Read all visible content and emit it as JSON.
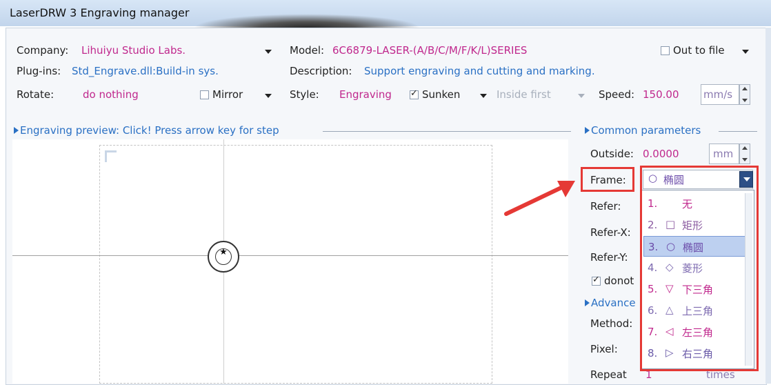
{
  "window": {
    "title": "LaserDRW 3 Engraving manager"
  },
  "company": {
    "label": "Company:",
    "value": "Lihuiyu Studio Labs."
  },
  "model": {
    "label": "Model:",
    "value": "6C6879-LASER-(A/B/C/M/F/K/L)SERIES"
  },
  "out_to_file": {
    "label": "Out to file",
    "checked": false
  },
  "plugins": {
    "label": "Plug-ins:",
    "value": "Std_Engrave.dll:Build-in sys."
  },
  "description": {
    "label": "Description:",
    "value": "Support engraving and cutting and marking."
  },
  "rotate": {
    "label": "Rotate:",
    "value": "do nothing"
  },
  "mirror": {
    "label": "Mirror",
    "checked": false
  },
  "style": {
    "label": "Style:",
    "value": "Engraving"
  },
  "sunken": {
    "label": "Sunken",
    "checked": true
  },
  "inside_first": {
    "value": "Inside first"
  },
  "speed": {
    "label": "Speed:",
    "value": "150.00",
    "unit": "mm/s"
  },
  "preview": {
    "header": "Engraving preview: Click! Press arrow key for step"
  },
  "common": {
    "header": "Common parameters",
    "outside_label": "Outside:",
    "outside_value": "0.0000",
    "outside_unit": "mm",
    "frame_label": "Frame:",
    "frame_value": "椭圆",
    "refer_label": "Refer:",
    "refer_x_label": "Refer-X:",
    "refer_y_label": "Refer-Y:",
    "donot_label": "donot",
    "donot_checked": true
  },
  "advanced": {
    "header": "Advance",
    "method_label": "Method:",
    "pixel_label": "Pixel:",
    "repeat_label": "Repeat",
    "repeat_value": "1",
    "repeat_unit": "times"
  },
  "frame_options": [
    {
      "num": "1.",
      "symbol": "",
      "text": "无",
      "color": "#c0288d"
    },
    {
      "num": "2.",
      "symbol": "□",
      "text": "矩形",
      "color": "#8a5aa0"
    },
    {
      "num": "3.",
      "symbol": "○",
      "text": "椭圆",
      "color": "#6a4aa8",
      "selected": true
    },
    {
      "num": "4.",
      "symbol": "◇",
      "text": "菱形",
      "color": "#7d6ab0"
    },
    {
      "num": "5.",
      "symbol": "▽",
      "text": "下三角",
      "color": "#c0288d"
    },
    {
      "num": "6.",
      "symbol": "△",
      "text": "上三角",
      "color": "#7d6ab0"
    },
    {
      "num": "7.",
      "symbol": "◁",
      "text": "左三角",
      "color": "#c0288d"
    },
    {
      "num": "8.",
      "symbol": "▷",
      "text": "右三角",
      "color": "#6a5aa8"
    }
  ],
  "colors": {
    "value_magenta": "#c0288d",
    "value_blue": "#2a70c4",
    "highlight_red": "#e53935"
  }
}
